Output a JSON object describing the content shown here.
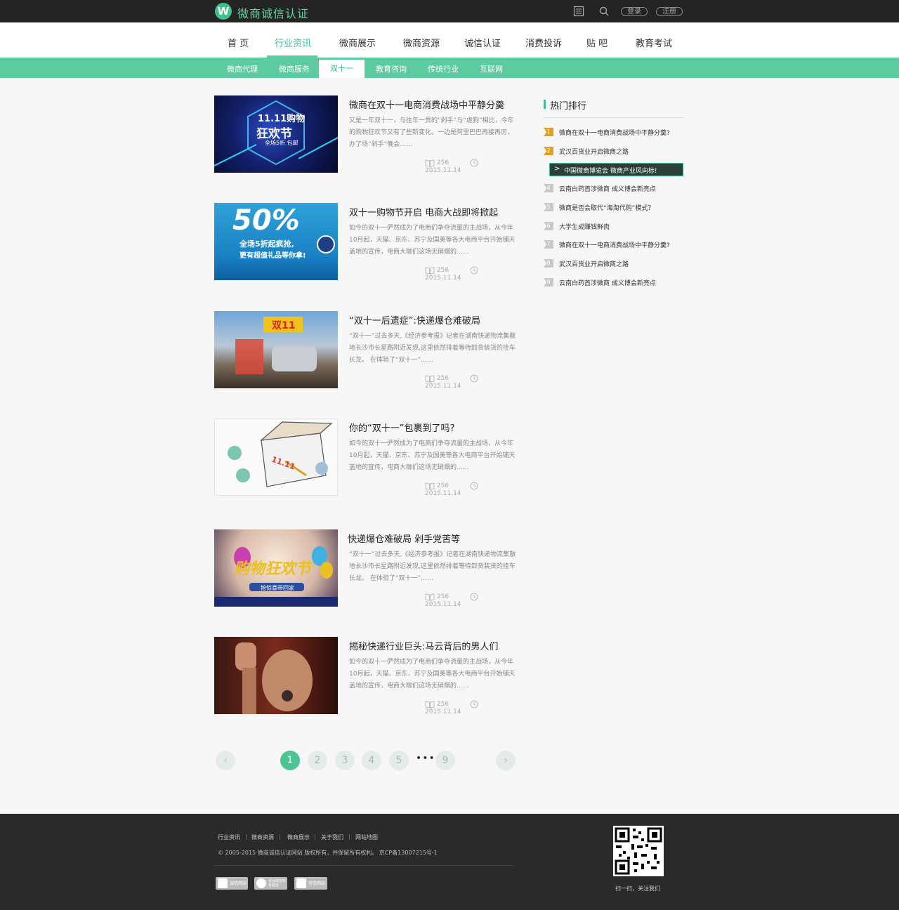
{
  "brand": {
    "logo_letter": "W",
    "name": "微商诚信认证"
  },
  "topbar": {
    "login": "登录",
    "register": "注册"
  },
  "main_nav": [
    "首 页",
    "行业资讯",
    "微商展示",
    "微商资源",
    "诚信认证",
    "消费投诉",
    "贴 吧",
    "教育考试"
  ],
  "sub_nav": [
    "微商代理",
    "微商服务",
    "双十一",
    "教育咨询",
    "传统行业",
    "互联网"
  ],
  "articles": [
    {
      "title": "微商在双十一电商消费战场中平静分羹",
      "excerpt": "又是一年双十一，与往年一贯的“剁手”与“虐狗”相比，今年的购物狂欢节又有了些新变化。一边是阿里巴巴再接再厉，办了场“剁手”晚会……",
      "views": "256",
      "date": "2015.11.14",
      "thumb": {
        "big": "11.11购物",
        "mid": "狂欢节",
        "small": "全场5折 包邮"
      }
    },
    {
      "title": "双十一购物节开启 电商大战即将掀起",
      "excerpt": "如今的双十一俨然成为了电商们争夺流量的主战场，从今年10月起，天猫、京东、苏宁及国美等各大电商平台开始铺天盖地的宣传，电商大咖们这场无硝烟的……",
      "views": "256",
      "date": "2015.11.14",
      "thumb": {
        "big": "50%",
        "mid": "全场5折起疯抢,",
        "small": "更有超值礼品等你拿!"
      }
    },
    {
      "title": "“双十一后遗症”:快递爆仓难破局",
      "excerpt": "“双十一”过去多天,《经济参考报》记者在湖南快递物流集散地长沙市长星路附近发现,这里依然排着等待卸货装货的挂车长龙。 在体验了“双十一”……",
      "views": "256",
      "date": "2015.11.14",
      "thumb": {
        "big": "双11",
        "mid": "",
        "small": ""
      }
    },
    {
      "title": "你的“双十一”包裹到了吗?",
      "excerpt": "如今的双十一俨然成为了电商们争夺流量的主战场，从今年10月起，天猫、京东、苏宁及国美等各大电商平台开始铺天盖地的宣传，电商大咖们这场无硝烟的……",
      "views": "256",
      "date": "2015.11.14",
      "thumb": {
        "big": "11.11",
        "mid": "",
        "small": ""
      }
    },
    {
      "title": "快递爆仓难破局 剁手党苦等",
      "excerpt": "“双十一”过去多天,《经济参考报》记者在湖南快递物流集散地长沙市长星路附近发现,这里依然排着等待卸货装货的挂车长龙。 在体验了“双十一”……",
      "views": "256",
      "date": "2015.11.14",
      "thumb": {
        "big": "购物狂欢节",
        "mid": "抢惊喜带回家",
        "small": ""
      }
    },
    {
      "title": "揭秘快递行业巨头:马云背后的男人们",
      "excerpt": "如今的双十一俨然成为了电商们争夺流量的主战场，从今年10月起，天猫、京东、苏宁及国美等各大电商平台开始铺天盖地的宣传，电商大咖们这场无硝烟的……",
      "views": "256",
      "date": "2015.11.14",
      "thumb": {
        "big": "",
        "mid": "",
        "small": ""
      }
    }
  ],
  "sidebar": {
    "title": "热门排行",
    "items": [
      {
        "rank": "1",
        "text": "微商在双十一电商消费战场中平静分羹?"
      },
      {
        "rank": "2",
        "text": "武汉百货业开启微商之路"
      },
      {
        "rank": ">",
        "text": "中国微商博览会 微商产业风向标!"
      },
      {
        "rank": "4",
        "text": "云南白药首涉微商 成义博会新亮点"
      },
      {
        "rank": "5",
        "text": "微商是否会取代“海淘代购”模式？"
      },
      {
        "rank": "6",
        "text": "大学生成赚钱鲜肉"
      },
      {
        "rank": "7",
        "text": "微商在双十一电商消费战场中平静分羹?"
      },
      {
        "rank": "8",
        "text": "武汉百货业开启微商之路"
      },
      {
        "rank": "9",
        "text": "云南白药首涉微商 成义博会新亮点"
      }
    ]
  },
  "pagination": {
    "pages": [
      "1",
      "2",
      "3",
      "4",
      "5",
      "9"
    ],
    "current": "1",
    "ellipsis": "•••",
    "prev": "‹",
    "next": "›"
  },
  "footer": {
    "links": [
      "行业资讯",
      "微商资源",
      "微商展示",
      "关于我们",
      "网站地图"
    ],
    "separator": "|",
    "copyright": "© 2005-2015 微商诚信认证网站 版权所有，并保留所有权利。 京CP备13007215号-1",
    "badges": [
      "诚信网站",
      "安全联盟实名验证",
      "可信网站"
    ],
    "qr_caption": "扫一扫，关注我们"
  },
  "colors": {
    "accent": "#5ccba0",
    "topbar": "#242424",
    "footer": "#2a2a2a",
    "rank_hot": "#e0a020",
    "rank_normal": "#c8c8c8"
  }
}
